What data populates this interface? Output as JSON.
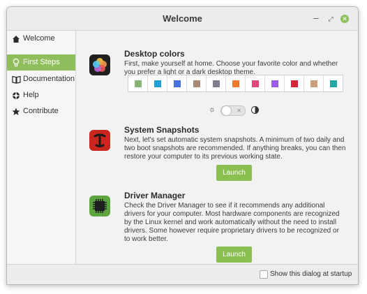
{
  "window": {
    "title": "Welcome"
  },
  "window_controls": {
    "minimize": "‒",
    "maximize": "⤢",
    "close": "✕"
  },
  "sidebar": {
    "items": [
      {
        "label": "Welcome",
        "icon": "home-icon"
      },
      {
        "label": "First Steps",
        "icon": "lightbulb-icon",
        "active": true
      },
      {
        "label": "Documentation",
        "icon": "book-icon"
      },
      {
        "label": "Help",
        "icon": "lifebuoy-icon"
      },
      {
        "label": "Contribute",
        "icon": "star-icon"
      }
    ]
  },
  "sections": {
    "desktop_colors": {
      "title": "Desktop colors",
      "description": "First, make yourself at home. Choose your favorite color and whether you prefer a light or a dark desktop theme.",
      "icon": "color-palette-icon",
      "swatches": [
        "#89b276",
        "#1e9fd9",
        "#4a71de",
        "#a88a75",
        "#7e7e8e",
        "#ef7a2f",
        "#e0457c",
        "#9b5ce6",
        "#d6243b",
        "#cc9f7c",
        "#23a6a6"
      ],
      "theme_toggle": {
        "state": "off",
        "off_glyph": "✕"
      }
    },
    "system_snapshots": {
      "title": "System Snapshots",
      "description": "Next, let's set automatic system snapshots. A minimum of two daily and two boot snapshots are recommended. If anything breaks, you can then restore your computer to its previous working state.",
      "icon": "timeshift-icon",
      "button": "Launch"
    },
    "driver_manager": {
      "title": "Driver Manager",
      "description": "Check the Driver Manager to see if it recommends any additional drivers for your computer. Most hardware components are recognized by the Linux kernel and work automatically without the need to install drivers. Some however require proprietary drivers to be recognized or to work better.",
      "icon": "chip-icon",
      "button": "Launch"
    }
  },
  "footer": {
    "show_at_startup_label": "Show this dialog at startup",
    "checked": false
  }
}
